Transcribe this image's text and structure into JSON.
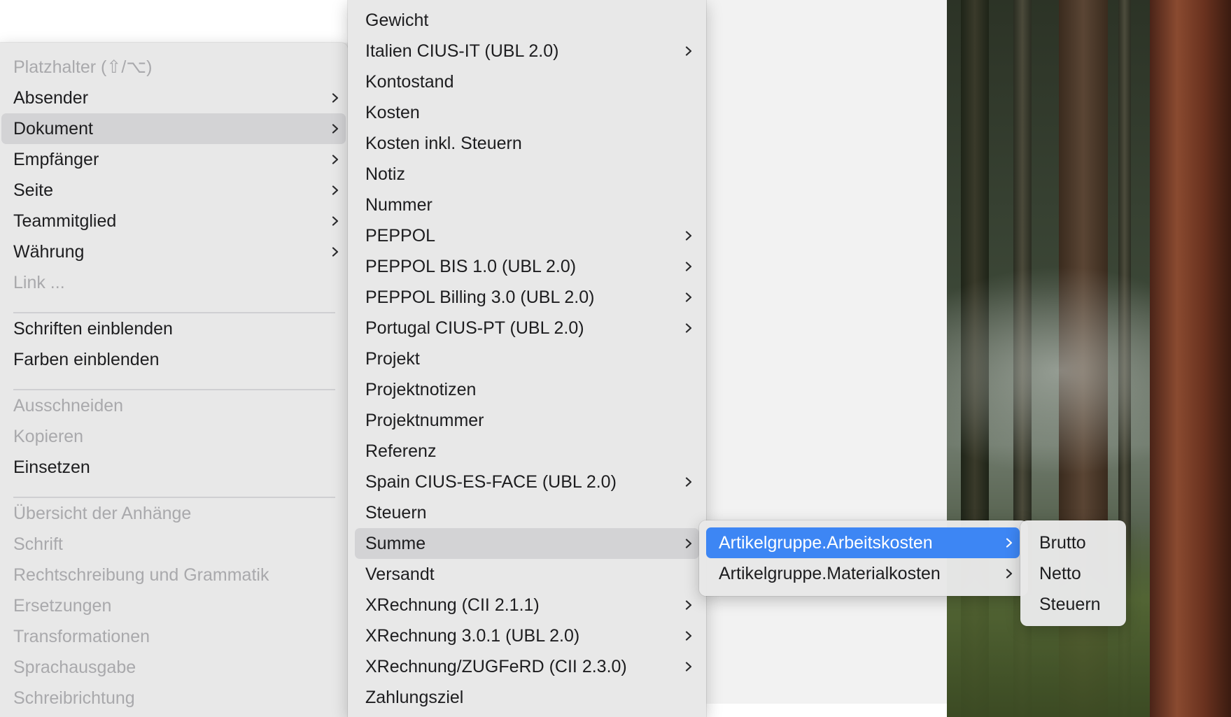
{
  "main_menu": {
    "items": [
      {
        "label": "Platzhalter (⇧/⌥)",
        "disabled": true,
        "submenu": false
      },
      {
        "label": "Absender",
        "disabled": false,
        "submenu": true
      },
      {
        "label": "Dokument",
        "disabled": false,
        "submenu": true,
        "hover": true
      },
      {
        "label": "Empfänger",
        "disabled": false,
        "submenu": true
      },
      {
        "label": "Seite",
        "disabled": false,
        "submenu": true
      },
      {
        "label": "Teammitglied",
        "disabled": false,
        "submenu": true
      },
      {
        "label": "Währung",
        "disabled": false,
        "submenu": true
      },
      {
        "label": "Link ...",
        "disabled": true,
        "submenu": false
      },
      {
        "separator": true
      },
      {
        "label": "Schriften einblenden",
        "disabled": false,
        "submenu": false
      },
      {
        "label": "Farben einblenden",
        "disabled": false,
        "submenu": false
      },
      {
        "separator": true
      },
      {
        "label": "Ausschneiden",
        "disabled": true,
        "submenu": false
      },
      {
        "label": "Kopieren",
        "disabled": true,
        "submenu": false
      },
      {
        "label": "Einsetzen",
        "disabled": false,
        "submenu": false
      },
      {
        "separator": true
      },
      {
        "label": "Übersicht der Anhänge",
        "disabled": true,
        "submenu": false
      },
      {
        "label": "Schrift",
        "disabled": true,
        "submenu": false
      },
      {
        "label": "Rechtschreibung und Grammatik",
        "disabled": true,
        "submenu": false
      },
      {
        "label": "Ersetzungen",
        "disabled": true,
        "submenu": false
      },
      {
        "label": "Transformationen",
        "disabled": true,
        "submenu": false
      },
      {
        "label": "Sprachausgabe",
        "disabled": true,
        "submenu": false
      },
      {
        "label": "Schreibrichtung",
        "disabled": true,
        "submenu": false
      }
    ]
  },
  "dokument_menu": {
    "items": [
      {
        "label": "Gewicht",
        "submenu": false
      },
      {
        "label": "Italien CIUS-IT (UBL 2.0)",
        "submenu": true
      },
      {
        "label": "Kontostand",
        "submenu": false
      },
      {
        "label": "Kosten",
        "submenu": false
      },
      {
        "label": "Kosten inkl. Steuern",
        "submenu": false
      },
      {
        "label": "Notiz",
        "submenu": false
      },
      {
        "label": "Nummer",
        "submenu": false
      },
      {
        "label": "PEPPOL",
        "submenu": true
      },
      {
        "label": "PEPPOL BIS 1.0 (UBL 2.0)",
        "submenu": true
      },
      {
        "label": "PEPPOL Billing 3.0 (UBL 2.0)",
        "submenu": true
      },
      {
        "label": "Portugal CIUS-PT (UBL 2.0)",
        "submenu": true
      },
      {
        "label": "Projekt",
        "submenu": false
      },
      {
        "label": "Projektnotizen",
        "submenu": false
      },
      {
        "label": "Projektnummer",
        "submenu": false
      },
      {
        "label": "Referenz",
        "submenu": false
      },
      {
        "label": "Spain CIUS-ES-FACE (UBL 2.0)",
        "submenu": true
      },
      {
        "label": "Steuern",
        "submenu": false
      },
      {
        "label": "Summe",
        "submenu": true,
        "hover": true
      },
      {
        "label": "Versandt",
        "submenu": false
      },
      {
        "label": "XRechnung (CII 2.1.1)",
        "submenu": true
      },
      {
        "label": "XRechnung 3.0.1 (UBL 2.0)",
        "submenu": true
      },
      {
        "label": "XRechnung/ZUGFeRD (CII 2.3.0)",
        "submenu": true
      },
      {
        "label": "Zahlungsziel",
        "submenu": false
      }
    ]
  },
  "summe_menu": {
    "items": [
      {
        "label": "Artikelgruppe.Arbeitskosten",
        "submenu": true,
        "selected": true
      },
      {
        "label": "Artikelgruppe.Materialkosten",
        "submenu": true
      }
    ]
  },
  "arbeitskosten_menu": {
    "items": [
      {
        "label": "Brutto"
      },
      {
        "label": "Netto"
      },
      {
        "label": "Steuern"
      }
    ]
  },
  "colors": {
    "menu_background": "#e8e8e8",
    "hover_background": "#d3d3d5",
    "selected_background": "#3d86f4",
    "disabled_text": "#a9a9ac"
  }
}
